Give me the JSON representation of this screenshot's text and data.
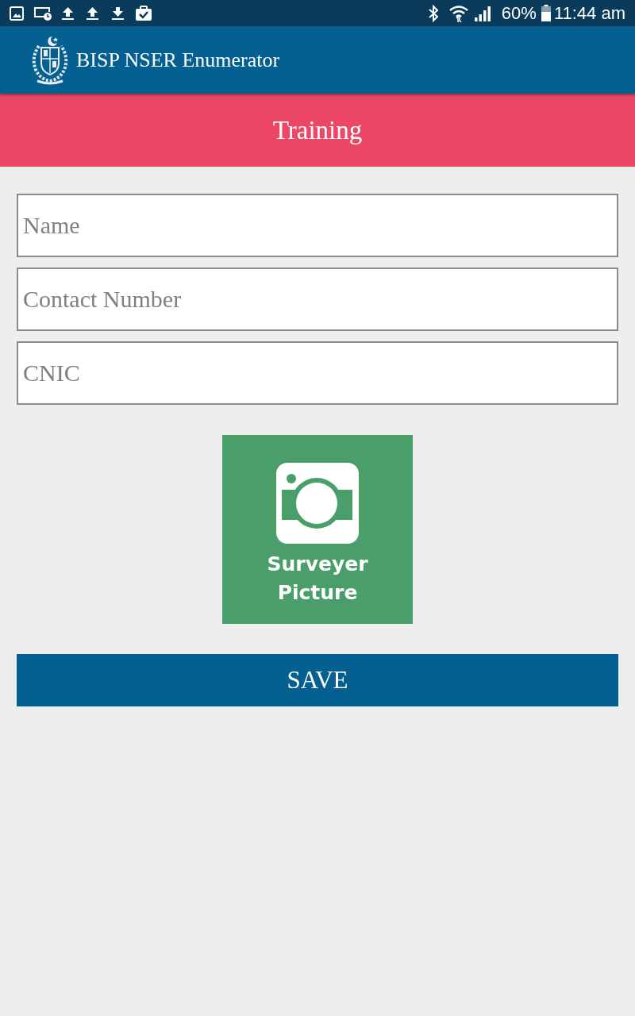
{
  "status_bar": {
    "battery": "60%",
    "time": "11:44 am"
  },
  "app_bar": {
    "title": "BISP NSER Enumerator"
  },
  "screen_header": {
    "title": "Training"
  },
  "form": {
    "fields": [
      {
        "placeholder": "Name"
      },
      {
        "placeholder": "Contact Number"
      },
      {
        "placeholder": "CNIC"
      }
    ],
    "picture_button": {
      "label": "Surveyer Picture"
    },
    "save_button": {
      "label": "SAVE"
    }
  }
}
